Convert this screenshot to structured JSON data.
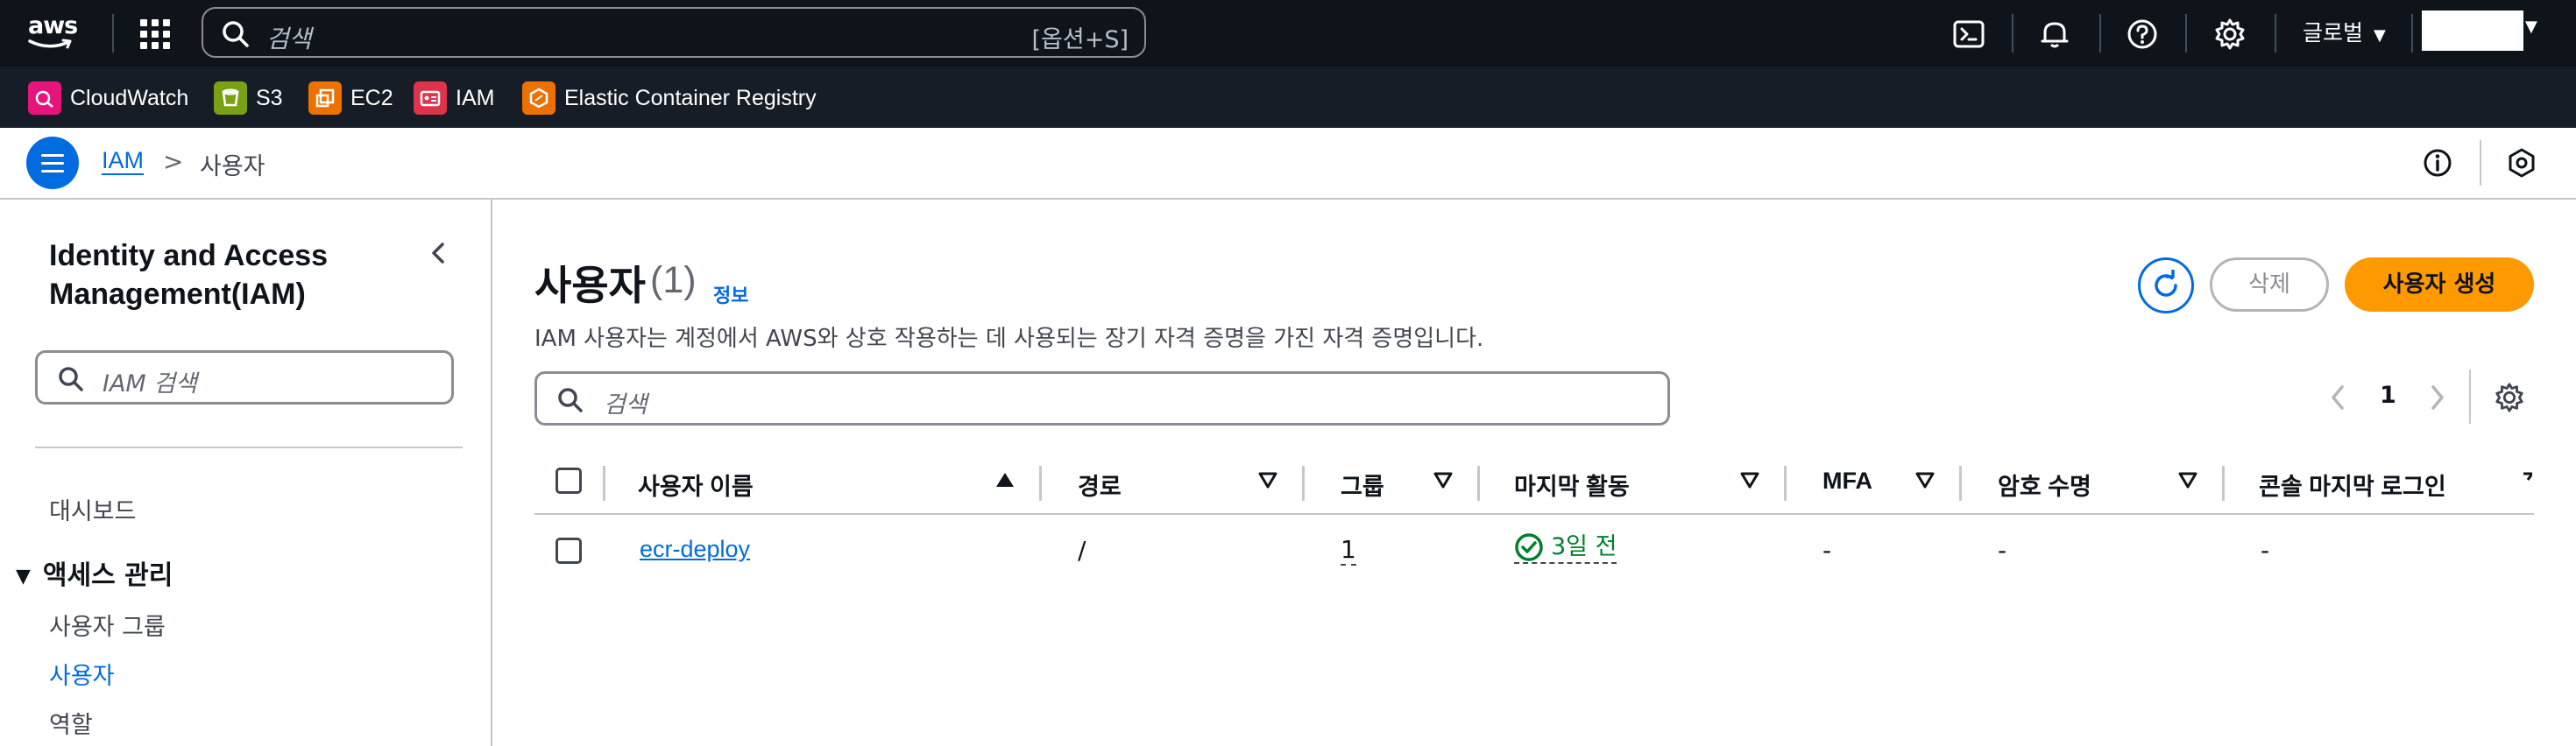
{
  "topnav": {
    "logo_text": "aws",
    "search_placeholder": "검색",
    "search_shortcut": "[옵션+S]",
    "region_label": "글로벌",
    "icons": [
      "services-grid-icon",
      "cloudshell-icon",
      "notifications-bell-icon",
      "help-icon",
      "settings-gear-icon"
    ]
  },
  "favorites": [
    {
      "label": "CloudWatch",
      "color": "#e7157b",
      "icon": "cloudwatch-icon"
    },
    {
      "label": "S3",
      "color": "#7aa116",
      "icon": "s3-icon"
    },
    {
      "label": "EC2",
      "color": "#ed7100",
      "icon": "ec2-icon"
    },
    {
      "label": "IAM",
      "color": "#dd344c",
      "icon": "iam-icon"
    },
    {
      "label": "Elastic Container Registry",
      "color": "#ed7100",
      "icon": "ecr-icon"
    }
  ],
  "breadcrumb": {
    "root": "IAM",
    "separator": ">",
    "current": "사용자"
  },
  "sidebar": {
    "title": "Identity and Access Management(IAM)",
    "search_placeholder": "IAM 검색",
    "dashboard": "대시보드",
    "section": "액세스 관리",
    "items": [
      {
        "label": "사용자 그룹",
        "active": false
      },
      {
        "label": "사용자",
        "active": true
      },
      {
        "label": "역할",
        "active": false
      }
    ]
  },
  "main": {
    "title": "사용자",
    "count": "(1)",
    "info": "정보",
    "description": "IAM 사용자는 계정에서 AWS와 상호 작용하는 데 사용되는 장기 자격 증명을 가진 자격 증명입니다.",
    "delete_label": "삭제",
    "create_label": "사용자 생성",
    "filter_placeholder": "검색",
    "page_number": "1"
  },
  "table": {
    "columns": [
      "사용자 이름",
      "경로",
      "그룹",
      "마지막 활동",
      "MFA",
      "암호 수명",
      "콘솔 마지막 로그인"
    ],
    "rows": [
      {
        "user_name": "ecr-deploy",
        "path": "/",
        "groups": "1",
        "last_activity": "3일 전",
        "mfa": "-",
        "password_age": "-",
        "console_last_login": "-"
      }
    ]
  },
  "colors": {
    "nav_bg": "#0f141a",
    "fav_bg": "#161d26",
    "link_blue": "#006ce0",
    "primary_orange": "#ff9900",
    "success_green": "#00802f"
  }
}
